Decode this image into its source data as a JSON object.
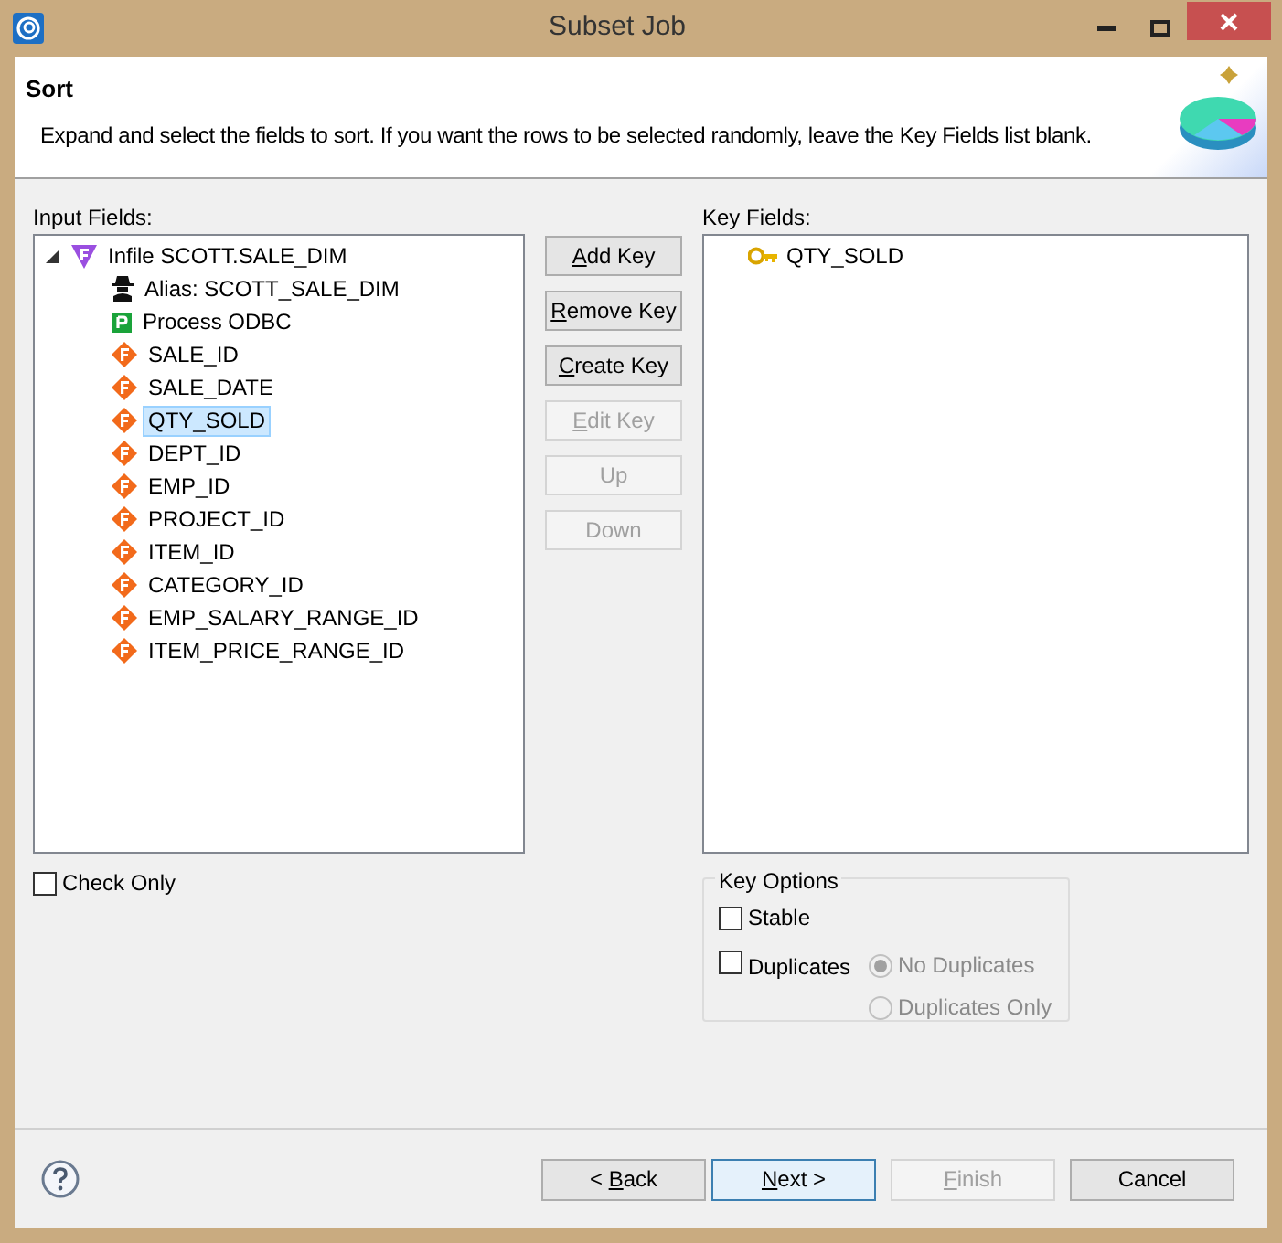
{
  "window": {
    "title": "Subset Job"
  },
  "header": {
    "title": "Sort",
    "description": "Expand and select the fields to sort. If you want the rows to be selected randomly, leave the Key Fields list blank."
  },
  "input_fields": {
    "label": "Input Fields:",
    "tree": [
      {
        "kind": "infile",
        "label": "Infile SCOTT.SALE_DIM",
        "expanded": true,
        "selected": false,
        "children": [
          {
            "kind": "alias",
            "label": "Alias: SCOTT_SALE_DIM",
            "selected": false
          },
          {
            "kind": "process",
            "label": "Process ODBC",
            "selected": false
          },
          {
            "kind": "field",
            "label": "SALE_ID",
            "selected": false
          },
          {
            "kind": "field",
            "label": "SALE_DATE",
            "selected": false
          },
          {
            "kind": "field",
            "label": "QTY_SOLD",
            "selected": true
          },
          {
            "kind": "field",
            "label": "DEPT_ID",
            "selected": false
          },
          {
            "kind": "field",
            "label": "EMP_ID",
            "selected": false
          },
          {
            "kind": "field",
            "label": "PROJECT_ID",
            "selected": false
          },
          {
            "kind": "field",
            "label": "ITEM_ID",
            "selected": false
          },
          {
            "kind": "field",
            "label": "CATEGORY_ID",
            "selected": false
          },
          {
            "kind": "field",
            "label": "EMP_SALARY_RANGE_ID",
            "selected": false
          },
          {
            "kind": "field",
            "label": "ITEM_PRICE_RANGE_ID",
            "selected": false
          }
        ]
      }
    ]
  },
  "key_buttons": [
    {
      "mnemonic": "A",
      "after": "dd Key",
      "disabled": false
    },
    {
      "mnemonic": "R",
      "after": "emove Key",
      "disabled": false
    },
    {
      "mnemonic": "C",
      "after": "reate Key",
      "disabled": false
    },
    {
      "mnemonic": "E",
      "after": "dit Key",
      "disabled": true
    },
    {
      "after": "Up",
      "disabled": true
    },
    {
      "after": "Down",
      "disabled": true
    }
  ],
  "key_fields": {
    "label": "Key Fields:",
    "items": [
      {
        "label": "QTY_SOLD"
      }
    ]
  },
  "check_only": {
    "label": "Check Only",
    "checked": false
  },
  "key_options": {
    "title": "Key Options",
    "stable": {
      "label": "Stable",
      "checked": false
    },
    "duplicates": {
      "label": "Duplicates",
      "checked": false
    },
    "radios": [
      {
        "label": "No Duplicates",
        "selected": true,
        "disabled": true
      },
      {
        "label": "Duplicates Only",
        "selected": false,
        "disabled": true
      }
    ]
  },
  "footer_buttons": [
    {
      "before": "< ",
      "mnemonic": "B",
      "after": "ack",
      "disabled": false,
      "default": false
    },
    {
      "mnemonic": "N",
      "after": "ext >",
      "disabled": false,
      "default": true
    },
    {
      "mnemonic": "F",
      "after": "inish",
      "disabled": true,
      "default": false
    },
    {
      "after": "Cancel",
      "disabled": false,
      "default": false
    }
  ]
}
